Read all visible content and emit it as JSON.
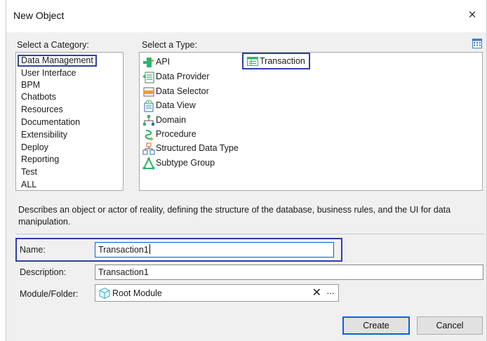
{
  "window": {
    "title": "New Object",
    "close_glyph": "×"
  },
  "category": {
    "label": "Select a Category:",
    "items": [
      "Data Management",
      "User Interface",
      "BPM",
      "Chatbots",
      "Resources",
      "Documentation",
      "Extensibility",
      "Deploy",
      "Reporting",
      "Test",
      "ALL"
    ],
    "selected": "Data Management"
  },
  "type": {
    "label": "Select a Type:",
    "items": [
      {
        "label": "API",
        "icon": "api-icon"
      },
      {
        "label": "Data Provider",
        "icon": "data-provider-icon"
      },
      {
        "label": "Data Selector",
        "icon": "data-selector-icon"
      },
      {
        "label": "Data View",
        "icon": "data-view-icon"
      },
      {
        "label": "Domain",
        "icon": "domain-icon"
      },
      {
        "label": "Procedure",
        "icon": "procedure-icon"
      },
      {
        "label": "Structured Data Type",
        "icon": "structured-data-type-icon"
      },
      {
        "label": "Subtype Group",
        "icon": "subtype-group-icon"
      },
      {
        "label": "Transaction",
        "icon": "transaction-icon"
      }
    ],
    "selected": "Transaction"
  },
  "description_text": "Describes an object or actor of reality, defining the structure of the database, business rules, and the UI for data manipulation.",
  "form": {
    "name_label": "Name:",
    "name_value": "Transaction1",
    "description_label": "Description:",
    "description_value": "Transaction1",
    "module_label": "Module/Folder:",
    "module_value": "Root Module",
    "clear_glyph": "✕",
    "browse_glyph": "···"
  },
  "buttons": {
    "create": "Create",
    "cancel": "Cancel"
  },
  "colors": {
    "selection_border": "#2f3fa3",
    "focus_border": "#0b63ce",
    "dialog_bg": "#f0f0f0"
  }
}
